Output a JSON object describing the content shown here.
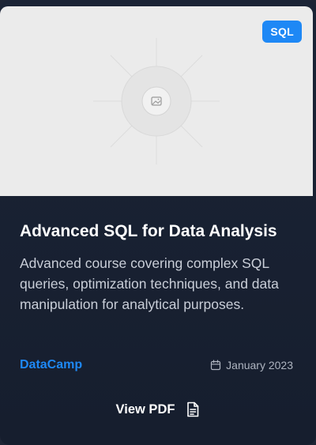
{
  "course": {
    "tag": "SQL",
    "title": "Advanced SQL for Data Analysis",
    "description": "Advanced course covering complex SQL queries, optimization techniques, and data manipulation for analytical purposes.",
    "provider": "DataCamp",
    "date": "January 2023",
    "view_label": "View PDF"
  },
  "icons": {
    "thumbnail": "image-placeholder-icon",
    "date": "calendar-icon",
    "view": "document-icon"
  },
  "colors": {
    "accent": "#1e88f5",
    "card_bg": "#1b2436",
    "thumb_bg": "#ebebeb"
  }
}
